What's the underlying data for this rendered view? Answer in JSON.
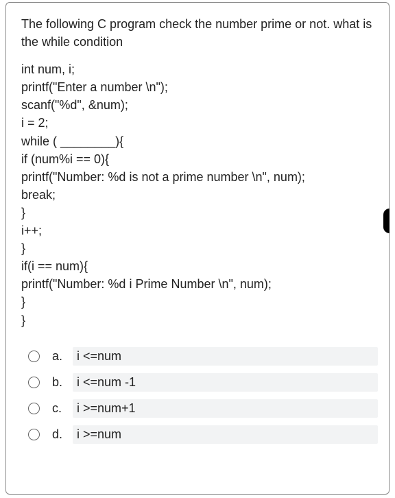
{
  "question": {
    "prompt": "The following C program check the number prime or not. what is the while condition",
    "code": "int num, i;\nprintf(\"Enter a number \\n\");\nscanf(\"%d\", &num);\ni = 2;\nwhile ( ________){\nif (num%i == 0){\nprintf(\"Number: %d is not a prime number \\n\", num);\nbreak;\n}\ni++;\n}\nif(i == num){\nprintf(\"Number: %d i Prime Number \\n\", num);\n}\n}"
  },
  "options": [
    {
      "letter": "a.",
      "text": "i <=num"
    },
    {
      "letter": "b.",
      "text": "i <=num -1"
    },
    {
      "letter": "c.",
      "text": "i >=num+1"
    },
    {
      "letter": "d.",
      "text": "i >=num"
    }
  ]
}
